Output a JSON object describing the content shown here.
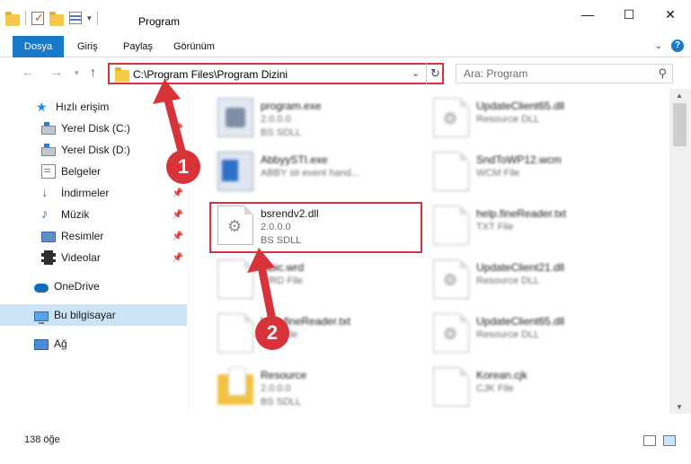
{
  "window": {
    "title": "Program"
  },
  "ribbon": {
    "tabs": [
      {
        "label": "Dosya",
        "active": true
      },
      {
        "label": "Giriş"
      },
      {
        "label": "Paylaş"
      },
      {
        "label": "Görünüm"
      }
    ],
    "help": "?"
  },
  "nav": {
    "address": "C:\\Program Files\\Program Dizini",
    "search_placeholder": "Ara: Program"
  },
  "sidebar": {
    "items": [
      {
        "label": "Hızlı erişim",
        "icon": "star-icon"
      },
      {
        "label": "Yerel Disk (C:)",
        "icon": "disk-icon",
        "pinned": true
      },
      {
        "label": "Yerel Disk (D:)",
        "icon": "disk-icon"
      },
      {
        "label": "Belgeler",
        "icon": "documents-icon",
        "pinned": true
      },
      {
        "label": "İndirmeler",
        "icon": "download-icon",
        "pinned": true
      },
      {
        "label": "Müzik",
        "icon": "music-icon",
        "pinned": true
      },
      {
        "label": "Resimler",
        "icon": "pictures-icon",
        "pinned": true
      },
      {
        "label": "Videolar",
        "icon": "video-icon",
        "pinned": true
      },
      {
        "label": "OneDrive",
        "icon": "cloud-icon"
      },
      {
        "label": "Bu bilgisayar",
        "icon": "computer-icon",
        "selected": true
      },
      {
        "label": "Ağ",
        "icon": "network-icon"
      }
    ]
  },
  "files": {
    "left": [
      {
        "name": "program.exe",
        "l2": "2.0.0.0",
        "l3": "BS SDLL",
        "blur": true,
        "thumb": "exe"
      },
      {
        "name": "AbbyySTI.exe",
        "l2": "ABBY sti event hand...",
        "l3": "",
        "blur": true,
        "thumb": "abby"
      },
      {
        "name": "bsrendv2.dll",
        "l2": "2.0.0.0",
        "l3": "BS SDLL",
        "blur": false,
        "thumb": "gear"
      },
      {
        "name": "fabic.wrd",
        "l2": "WRD File",
        "l3": "",
        "blur": true,
        "thumb": "page"
      },
      {
        "name": "help.fineReader.txt",
        "l2": "TXT File",
        "l3": "",
        "blur": true,
        "thumb": "page"
      },
      {
        "name": "Resource",
        "l2": "2.0.0.0",
        "l3": "BS SDLL",
        "blur": true,
        "thumb": "folder"
      }
    ],
    "right": [
      {
        "name": "UpdateClient65.dll",
        "l2": "Resource DLL",
        "blur": true,
        "thumb": "gear"
      },
      {
        "name": "SndToWP12.wcm",
        "l2": "WCM File",
        "blur": true,
        "thumb": "page"
      },
      {
        "name": "help.fineReader.txt",
        "l2": "TXT File",
        "blur": true,
        "thumb": "page"
      },
      {
        "name": "UpdateClient21.dll",
        "l2": "Resource DLL",
        "blur": true,
        "thumb": "gear"
      },
      {
        "name": "UpdateClient65.dll",
        "l2": "Resource DLL",
        "blur": true,
        "thumb": "gear"
      },
      {
        "name": "Korean.cjk",
        "l2": "CJK File",
        "blur": true,
        "thumb": "page"
      }
    ]
  },
  "annotations": {
    "badge1": "1",
    "badge2": "2",
    "accent": "#d9333a"
  },
  "status": {
    "count": "138 öğe"
  }
}
